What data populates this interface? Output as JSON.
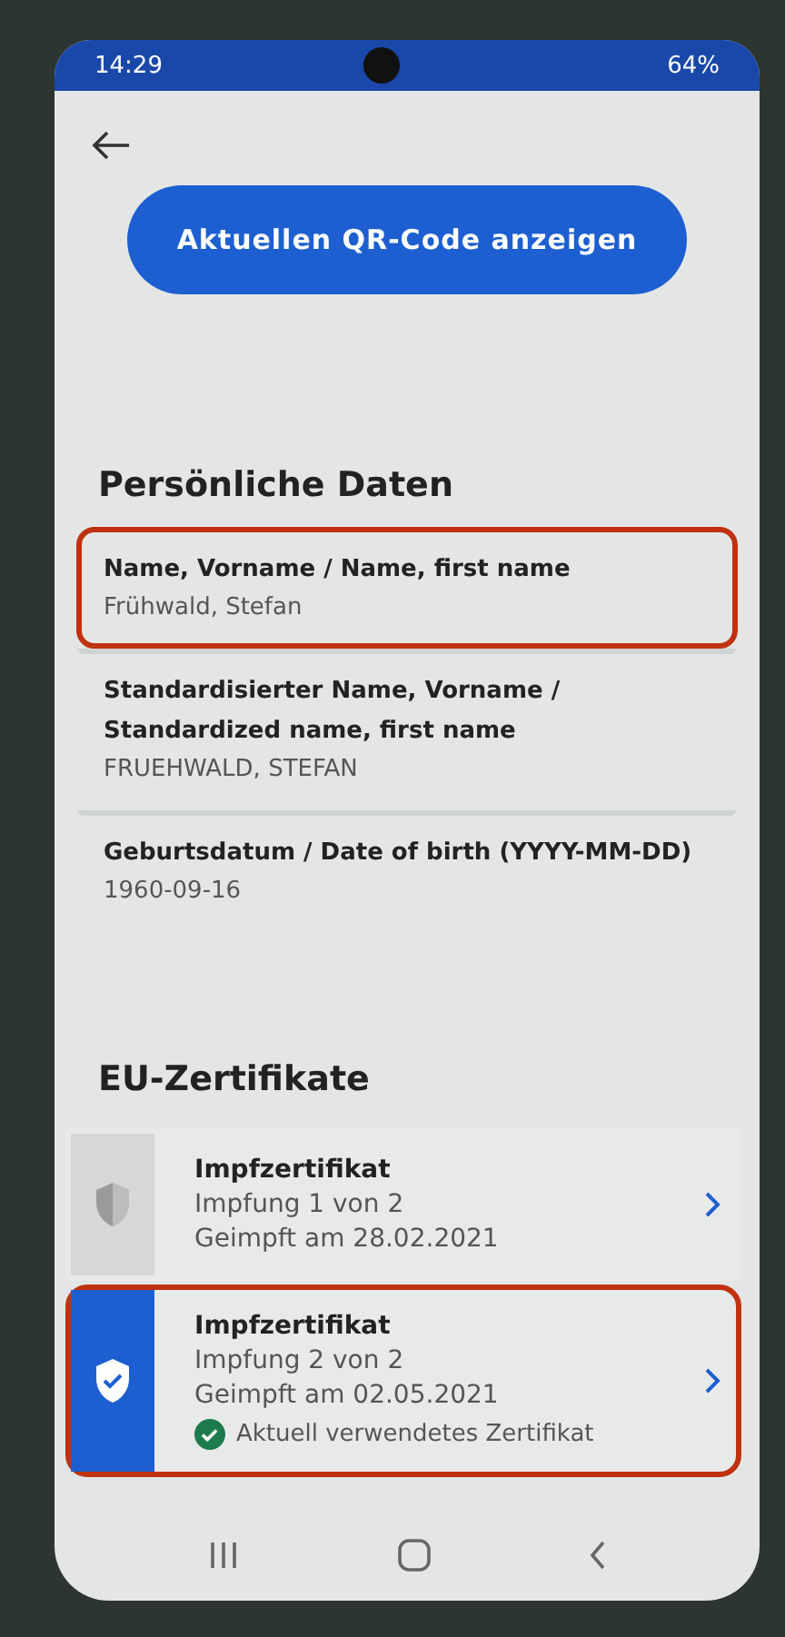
{
  "status_bar": {
    "time": "14:29",
    "battery": "64%"
  },
  "qr_button": {
    "label": "Aktuellen QR-Code anzeigen"
  },
  "personal": {
    "title": "Persönliche Daten",
    "fields": [
      {
        "label": "Name, Vorname / Name, first name",
        "value": "Frühwald, Stefan",
        "highlighted": true
      },
      {
        "label": "Standardisierter Name, Vorname / Standardized name, first name",
        "value": "FRUEHWALD, STEFAN",
        "highlighted": false
      },
      {
        "label": "Geburtsdatum / Date of birth (YYYY-MM-DD)",
        "value": "1960-09-16",
        "highlighted": false
      }
    ]
  },
  "certificates": {
    "title": "EU-Zertifikate",
    "items": [
      {
        "title": "Impfzertifikat",
        "dose": "Impfung 1 von 2",
        "date": "Geimpft am 28.02.2021",
        "selected": false,
        "highlighted": false
      },
      {
        "title": "Impfzertifikat",
        "dose": "Impfung 2 von 2",
        "date": "Geimpft am 02.05.2021",
        "selected": true,
        "highlighted": true,
        "status": "Aktuell verwendetes Zertifikat"
      }
    ]
  }
}
